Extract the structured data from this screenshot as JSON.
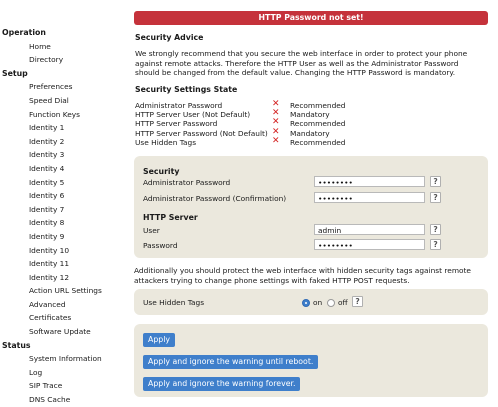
{
  "sidebar": {
    "sections": [
      {
        "title": "Operation",
        "items": [
          "Home",
          "Directory"
        ]
      },
      {
        "title": "Setup",
        "items": [
          "Preferences",
          "Speed Dial",
          "Function Keys",
          "Identity 1",
          "Identity 2",
          "Identity 3",
          "Identity 4",
          "Identity 5",
          "Identity 6",
          "Identity 7",
          "Identity 8",
          "Identity 9",
          "Identity 10",
          "Identity 11",
          "Identity 12",
          "Action URL Settings",
          "Advanced",
          "Certificates",
          "Software Update"
        ]
      },
      {
        "title": "Status",
        "items": [
          "System Information",
          "Log",
          "SIP Trace",
          "DNS Cache"
        ]
      }
    ]
  },
  "banner": "HTTP Password not set!",
  "advice": {
    "title": "Security Advice",
    "text": "We strongly recommend that you secure the web interface in order to protect your phone against remote attacks. Therefore the HTTP User as well as the Administrator Password should be changed from the default value. Changing the HTTP Password is mandatory."
  },
  "state": {
    "title": "Security Settings State",
    "rows": [
      {
        "label": "Administrator Password",
        "status": "Recommended"
      },
      {
        "label": "HTTP Server User (Not Default)",
        "status": "Mandatory"
      },
      {
        "label": "HTTP Server Password",
        "status": "Recommended"
      },
      {
        "label": "HTTP Server Password (Not Default)",
        "status": "Mandatory"
      },
      {
        "label": "Use Hidden Tags",
        "status": "Recommended"
      }
    ],
    "x_glyph": "✕"
  },
  "security_form": {
    "security_title": "Security",
    "admin_pw_label": "Administrator Password",
    "admin_pw_value": "••••••••",
    "admin_pw_confirm_label": "Administrator Password (Confirmation)",
    "admin_pw_confirm_value": "••••••••",
    "http_title": "HTTP Server",
    "user_label": "User",
    "user_value": "admin",
    "password_label": "Password",
    "password_value": "••••••••",
    "help": "?"
  },
  "hidden_tags": {
    "text": "Additionally you should protect the web interface with hidden security tags against remote attackers trying to change phone settings with faked HTTP POST requests.",
    "label": "Use Hidden Tags",
    "on_label": "on",
    "off_label": "off",
    "selected": "on"
  },
  "buttons": {
    "apply": "Apply",
    "apply_ignore_reboot": "Apply and ignore the warning until reboot.",
    "apply_ignore_forever": "Apply and ignore the warning forever."
  },
  "colors": {
    "banner": "#c5323b",
    "button": "#3f7fcb",
    "panel": "#ebe8dd",
    "x_mark": "#d31f1f"
  }
}
